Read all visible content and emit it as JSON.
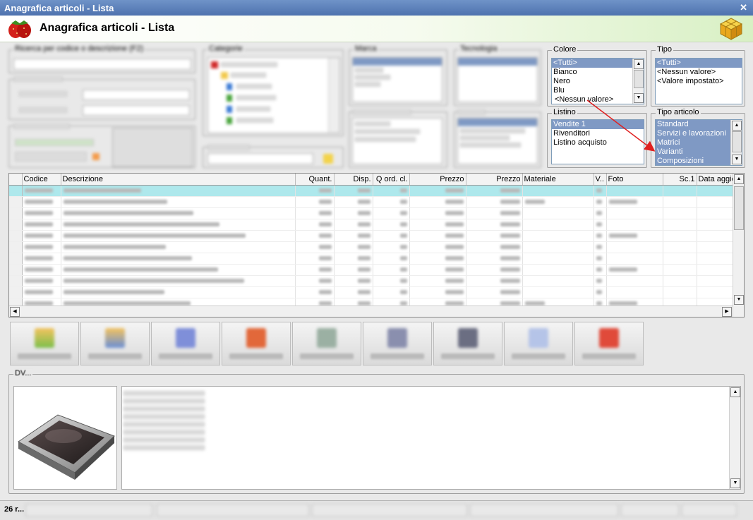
{
  "window": {
    "title": "Anagrafica articoli  - Lista",
    "close_glyph": "✕"
  },
  "header": {
    "title": "Anagrafica articoli  - Lista",
    "left_icon": "strawberry-logo-icon",
    "right_icon": "cube-logo-icon"
  },
  "filters": {
    "ricerca_label": "Ricerca per codice o descrizione (F2)",
    "categorie_label": "Categorie",
    "marca_label": "Marca",
    "tecnologia_label": "Tecnologia",
    "colore": {
      "label": "Colore",
      "items": [
        "<Tutti>",
        "Bianco",
        "Nero",
        "Blu",
        "<Nessun valore>"
      ],
      "selected": 0
    },
    "tipo": {
      "label": "Tipo",
      "items": [
        "<Tutti>",
        "<Nessun valore>",
        "<Valore impostato>"
      ],
      "selected": 0
    },
    "listino": {
      "label": "Listino",
      "items": [
        "Vendite 1",
        "Rivenditori",
        "Listino acquisto"
      ],
      "selected": 0
    },
    "tipo_articolo": {
      "label": "Tipo articolo",
      "items": [
        "Standard",
        "Servizi e lavorazioni",
        "Matrici",
        "Varianti",
        "Composizioni"
      ],
      "selected": [
        0,
        1,
        2,
        3,
        4
      ]
    }
  },
  "grid": {
    "columns": [
      "Codice",
      "Descrizione",
      "Quant.",
      "Disp.",
      "Q ord. cl.",
      "Prezzo",
      "Prezzo",
      "Materiale",
      "V..",
      "Foto",
      "Sc.1",
      "Data aggio"
    ],
    "row_count": 11,
    "highlighted_row": 0
  },
  "detail": {
    "label": "DV..."
  },
  "status": {
    "count_text": "26 r..."
  },
  "colors": {
    "accent": "#7f99c4",
    "highlight_row": "#aee8ec",
    "annotation_arrow": "#e02020"
  }
}
